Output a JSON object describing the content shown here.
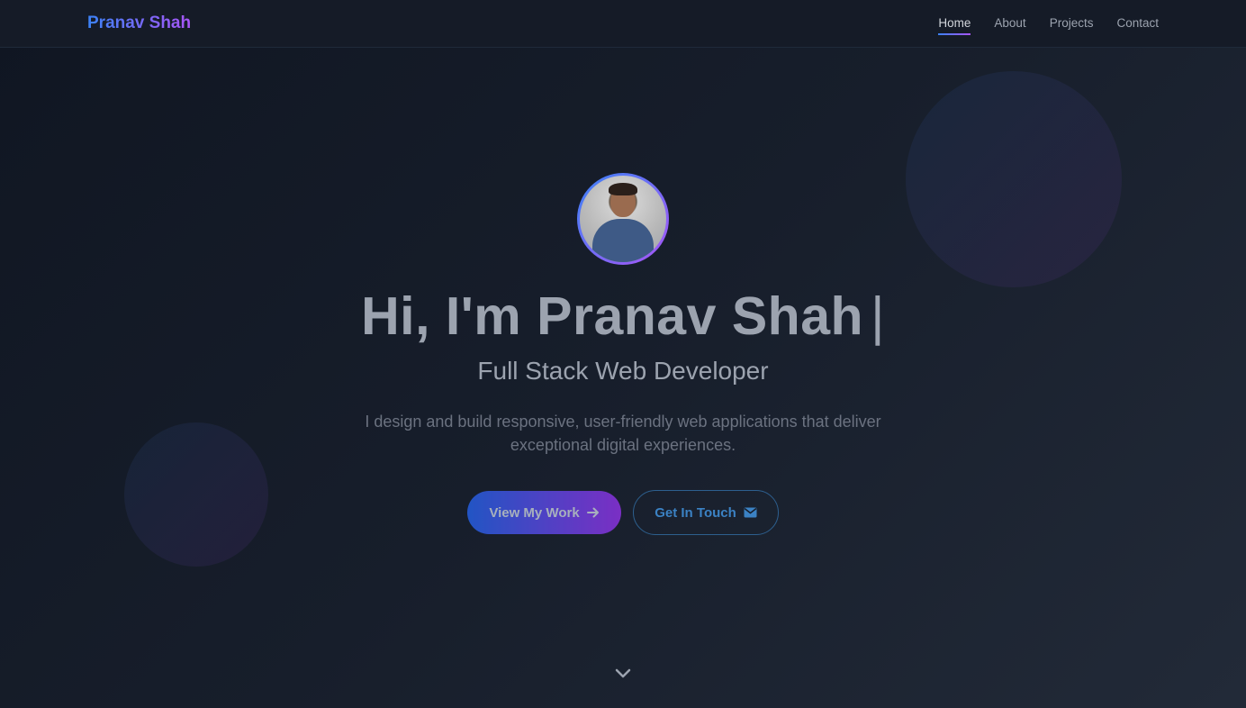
{
  "nav": {
    "brand": "Pranav Shah",
    "links": [
      {
        "label": "Home",
        "active": true
      },
      {
        "label": "About",
        "active": false
      },
      {
        "label": "Projects",
        "active": false
      },
      {
        "label": "Contact",
        "active": false
      }
    ]
  },
  "hero": {
    "title": "Hi, I'm Pranav Shah",
    "cursor": "|",
    "subtitle": "Full Stack Web Developer",
    "description": "I design and build responsive, user-friendly web applications that deliver exceptional digital experiences.",
    "primary_button": {
      "label": "View My Work",
      "icon": "arrow-right-icon"
    },
    "secondary_button": {
      "label": "Get In Touch",
      "icon": "envelope-icon"
    },
    "scroll_icon": "chevron-down-icon"
  },
  "colors": {
    "accent_blue": "#3b82f6",
    "accent_purple": "#a855f7",
    "background": "#171e2b"
  }
}
